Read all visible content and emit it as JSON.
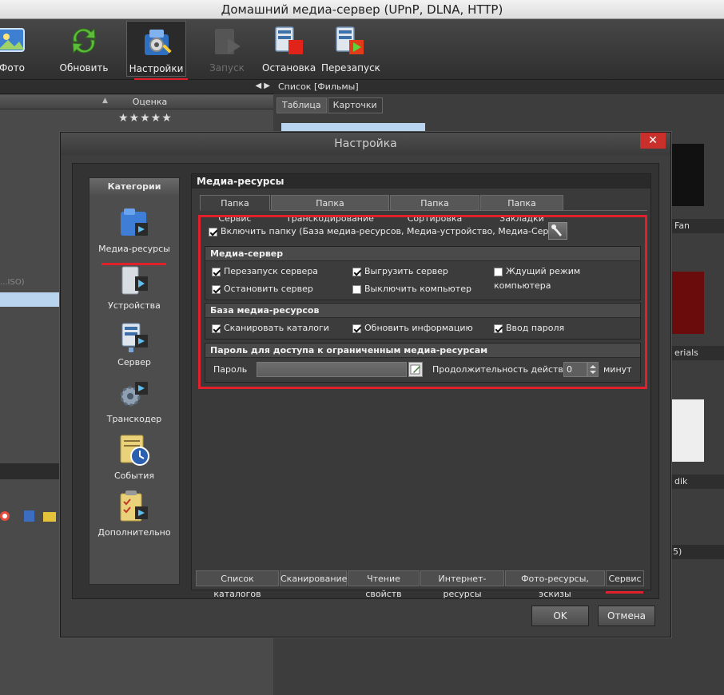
{
  "window": {
    "title": "Домашний медиа-сервер (UPnP, DLNA, HTTP)"
  },
  "toolbar": {
    "items": [
      {
        "label": "Фото",
        "icon": "photo-icon"
      },
      {
        "label": "Обновить",
        "icon": "refresh-icon"
      },
      {
        "label": "Настройки",
        "icon": "settings-icon",
        "active": true
      },
      {
        "label": "Запуск",
        "icon": "start-icon",
        "disabled": true
      },
      {
        "label": "Остановка",
        "icon": "stop-server-icon"
      },
      {
        "label": "Перезапуск",
        "icon": "restart-server-icon"
      }
    ]
  },
  "left_pane": {
    "column_rating": "Оценка",
    "stars": "★★★★★",
    "row_text": "...ISO)"
  },
  "right_pane": {
    "header": "Список [Фильмы]",
    "tabs": [
      "Таблица",
      "Карточки"
    ],
    "poster_labels": [
      "Fan",
      "erials",
      "dik"
    ],
    "status_fragment": "5)"
  },
  "dialog": {
    "title": "Настройка",
    "close_glyph": "✕",
    "categories": {
      "header": "Категории",
      "items": [
        {
          "label": "Медиа-ресурсы",
          "icon": "media-resources-icon"
        },
        {
          "label": "Устройства",
          "icon": "devices-icon"
        },
        {
          "label": "Сервер",
          "icon": "server-icon"
        },
        {
          "label": "Транскодер",
          "icon": "transcoder-icon"
        },
        {
          "label": "События",
          "icon": "events-icon"
        },
        {
          "label": "Дополнительно",
          "icon": "additional-icon"
        }
      ]
    },
    "content_title": "Медиа-ресурсы",
    "folder_tabs": [
      "Папка \"Сервис\"",
      "Папка \"Транскодирование\"",
      "Папка \"Сортировка\"",
      "Папка \"Закладки\""
    ],
    "enable_folder": {
      "label": "Включить папку (База медиа-ресурсов, Медиа-устройство, Медиа-Сервер)",
      "checked": true
    },
    "media_server": {
      "header": "Медиа-сервер",
      "options": [
        {
          "label": "Перезапуск сервера",
          "checked": true
        },
        {
          "label": "Выгрузить сервер",
          "checked": true
        },
        {
          "label": "Ждущий режим компьютера",
          "checked": false
        },
        {
          "label": "Остановить сервер",
          "checked": true
        },
        {
          "label": "Выключить компьютер",
          "checked": false
        }
      ]
    },
    "media_db": {
      "header": "База медиа-ресурсов",
      "options": [
        {
          "label": "Сканировать каталоги",
          "checked": true
        },
        {
          "label": "Обновить информацию",
          "checked": true
        },
        {
          "label": "Ввод пароля",
          "checked": true
        }
      ]
    },
    "password": {
      "header": "Пароль для доступа к ограниченным медиа-ресурсам",
      "label": "Пароль",
      "value": "",
      "duration_label": "Продолжительность действия",
      "duration_value": "0",
      "duration_unit": "минут"
    },
    "bottom_tabs": [
      "Список каталогов",
      "Сканирование",
      "Чтение свойств",
      "Интернет-ресурсы",
      "Фото-ресурсы, эскизы",
      "Сервис"
    ],
    "ok_label": "OK",
    "cancel_label": "Отмена"
  }
}
